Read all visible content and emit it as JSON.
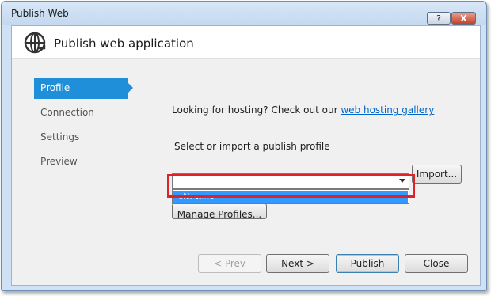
{
  "window": {
    "title": "Publish Web",
    "help_label": "?",
    "close_label": "X"
  },
  "header": {
    "title": "Publish web application",
    "icon": "globe-icon"
  },
  "sidebar": {
    "items": [
      {
        "label": "Profile",
        "active": true
      },
      {
        "label": "Connection",
        "active": false
      },
      {
        "label": "Settings",
        "active": false
      },
      {
        "label": "Preview",
        "active": false
      }
    ]
  },
  "profile": {
    "hosting_text": "Looking for hosting? Check out our ",
    "hosting_link": "web hosting gallery",
    "select_label": "Select or import a publish profile",
    "combo_value": "",
    "dropdown_option": "<New...>",
    "import_label": "Import...",
    "manage_label": "Manage Profiles..."
  },
  "footer": {
    "prev_label": "< Prev",
    "next_label": "Next >",
    "publish_label": "Publish",
    "close_label": "Close"
  },
  "colors": {
    "accent": "#1e8fd8",
    "selection": "#3399ff",
    "highlight": "#e0202a"
  }
}
